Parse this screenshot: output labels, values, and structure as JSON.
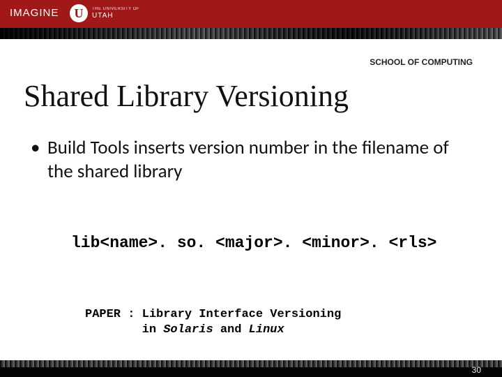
{
  "header": {
    "imagine": "IMAGINE",
    "logo_letter": "U",
    "uni_line1": "THE UNIVERSITY OF",
    "uni_line2": "UTAH"
  },
  "school_label": "SCHOOL OF COMPUTING",
  "title": "Shared Library Versioning",
  "bullets": [
    "Build Tools inserts version number in the filename of the shared library"
  ],
  "codeline": "lib<name>. so. <major>. <minor>. <rls>",
  "paper": {
    "prefix": "PAPER : ",
    "line1a": "Library Interface Versioning",
    "line2_indent": "        ",
    "line2a": "in ",
    "solaris": "Solaris",
    "line2b": " and ",
    "linux": "Linux"
  },
  "page_number": "30"
}
